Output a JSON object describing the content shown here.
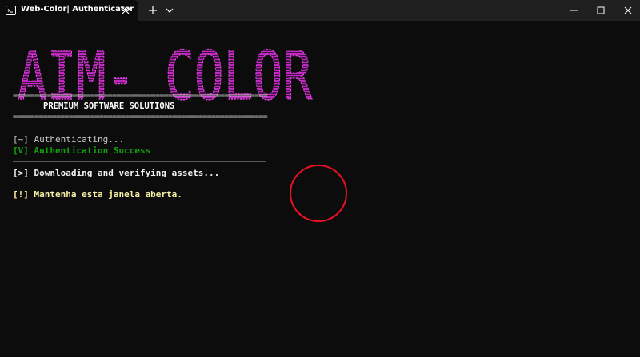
{
  "window": {
    "tab_title": "Web-Color| Authenticator",
    "icons": {
      "tab_icon": "terminal-icon",
      "close_tab": "close-icon",
      "new_tab": "plus-icon",
      "dropdown": "chevron-down-icon",
      "minimize": "minimize-icon",
      "maximize": "maximize-icon",
      "close_window": "close-icon"
    }
  },
  "terminal": {
    "banner": "AIM- COLOR",
    "rule_top": "===========================================================",
    "subtitle": "PREMIUM SOFTWARE SOLUTIONS",
    "rule_bottom": "===========================================================",
    "authenticating": "[~] Authenticating...",
    "success": "[V] Authentication Success",
    "divider": "__________________________________________________________",
    "downloading": "[>] Downloading and verifying assets...",
    "warning": "[!] Mantenha esta janela aberta."
  },
  "colors": {
    "background": "#0c0c0c",
    "titlebar": "#202020",
    "banner": "#c026c0",
    "success": "#13a10e",
    "warning": "#f9f1a5",
    "circle": "#e81123"
  }
}
